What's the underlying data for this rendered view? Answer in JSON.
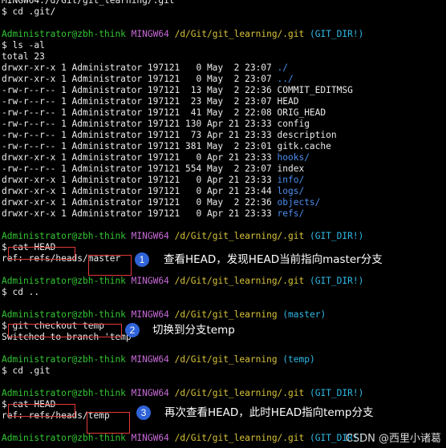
{
  "window_title": "MINGW64:/d/Git/git_learning/.git",
  "prompt": {
    "user": "Administrator@zbh-think",
    "shell": "MINGW64",
    "path_gitdir": "/d/Git/git_learning/.git",
    "path_repo": "/d/Git/git_learning",
    "branch_gitdir": "(GIT_DIR!)",
    "branch_master": "(master)",
    "branch_temp": "(temp)",
    "symbol": "$"
  },
  "commands": {
    "cd_git": "$ cd .git/",
    "ls": "$ ls -al",
    "cat_head_1": "cat HEAD",
    "cd_up": "$ cd ..",
    "checkout": "git checkout temp",
    "cd_git2": "$ cd .git",
    "cat_head_2": "cat HEAD"
  },
  "outputs": {
    "total": "total 23",
    "head_1_prefix": "ref: refs/heads/",
    "head_1_branch": "master",
    "switched": "Switched to branch 'temp'",
    "head_2_prefix": "ref: refs/heads/",
    "head_2_branch": "temp"
  },
  "listing": [
    {
      "meta": "drwxr-xr-x 1 Administrator 197121   0 May  2 23:07 ",
      "name": "./",
      "color": "blue"
    },
    {
      "meta": "drwxr-xr-x 1 Administrator 197121   0 May  2 23:07 ",
      "name": "../",
      "color": "blue"
    },
    {
      "meta": "-rw-r--r-- 1 Administrator 197121  13 May  2 22:36 ",
      "name": "COMMIT_EDITMSG",
      "color": "plain"
    },
    {
      "meta": "-rw-r--r-- 1 Administrator 197121  23 May  2 23:07 ",
      "name": "HEAD",
      "color": "plain"
    },
    {
      "meta": "-rw-r--r-- 1 Administrator 197121  41 May  2 22:08 ",
      "name": "ORIG_HEAD",
      "color": "plain"
    },
    {
      "meta": "-rw-r--r-- 1 Administrator 197121 130 Apr 21 23:33 ",
      "name": "config",
      "color": "plain"
    },
    {
      "meta": "-rw-r--r-- 1 Administrator 197121  73 Apr 21 23:33 ",
      "name": "description",
      "color": "plain"
    },
    {
      "meta": "-rw-r--r-- 1 Administrator 197121 381 May  2 23:01 ",
      "name": "gitk.cache",
      "color": "plain"
    },
    {
      "meta": "drwxr-xr-x 1 Administrator 197121   0 Apr 21 23:33 ",
      "name": "hooks/",
      "color": "blue"
    },
    {
      "meta": "-rw-r--r-- 1 Administrator 197121 554 May  2 23:07 ",
      "name": "index",
      "color": "plain"
    },
    {
      "meta": "drwxr-xr-x 1 Administrator 197121   0 Apr 21 23:33 ",
      "name": "info/",
      "color": "blue"
    },
    {
      "meta": "drwxr-xr-x 1 Administrator 197121   0 Apr 21 23:44 ",
      "name": "logs/",
      "color": "blue"
    },
    {
      "meta": "drwxr-xr-x 1 Administrator 197121   0 May  2 22:36 ",
      "name": "objects/",
      "color": "blue"
    },
    {
      "meta": "drwxr-xr-x 1 Administrator 197121   0 Apr 21 23:33 ",
      "name": "refs/",
      "color": "blue"
    }
  ],
  "annotations": {
    "badge_1": "1",
    "note_1": "查看HEAD，发现HEAD当前指向master分支",
    "badge_2": "2",
    "note_2": "切换到分支temp",
    "badge_3": "3",
    "note_3": "再次查看HEAD，此时HEAD指向temp分支"
  },
  "watermark": "CSDN @西里小诸葛",
  "colors": {
    "background": "#000000",
    "text": "#ececec",
    "prompt_user": "#34c734",
    "prompt_shell": "#c76bd8",
    "prompt_path": "#d7c23a",
    "prompt_branch": "#2fb9e6",
    "dir_name": "#4b8ef0",
    "highlight_box": "#e23a3a",
    "badge": "#2f63d8"
  }
}
